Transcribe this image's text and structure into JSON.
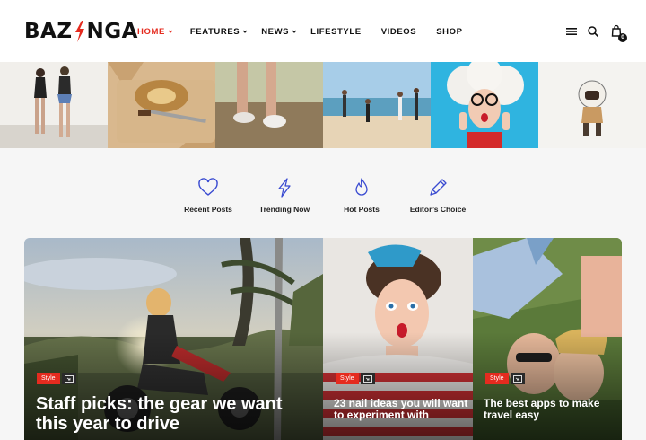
{
  "brand": {
    "part1": "BAZ",
    "part2": "NGA",
    "accent": "#e52b1f"
  },
  "nav": {
    "items": [
      {
        "label": "HOME",
        "dropdown": true,
        "active": true
      },
      {
        "label": "FEATURES",
        "dropdown": true
      },
      {
        "label": "NEWS",
        "dropdown": true
      },
      {
        "label": "LIFESTYLE",
        "dropdown": false
      },
      {
        "label": "VIDEOS",
        "dropdown": false
      },
      {
        "label": "SHOP",
        "dropdown": false
      }
    ],
    "menu_icon": "hamburger-icon",
    "search_icon": "search-icon",
    "cart_icon": "shopping-bag-icon",
    "cart_count": "0"
  },
  "strip": [
    "two-women-walking",
    "bread-on-paper",
    "running-shoes",
    "people-on-beach",
    "surprised-woman-glasses",
    "astronaut-helmet-figure"
  ],
  "categories": [
    {
      "label": "Recent Posts",
      "icon": "heart-icon"
    },
    {
      "label": "Trending Now",
      "icon": "lightning-icon"
    },
    {
      "label": "Hot Posts",
      "icon": "flame-icon"
    },
    {
      "label": "Editor’s Choice",
      "icon": "pen-icon"
    }
  ],
  "cards": [
    {
      "tag": "Style",
      "title": "Staff picks: the gear we want this year to drive"
    },
    {
      "tag": "Style",
      "title": "23 nail ideas you will want to experiment with"
    },
    {
      "tag": "Style",
      "title": "The best apps to make travel easy"
    }
  ]
}
